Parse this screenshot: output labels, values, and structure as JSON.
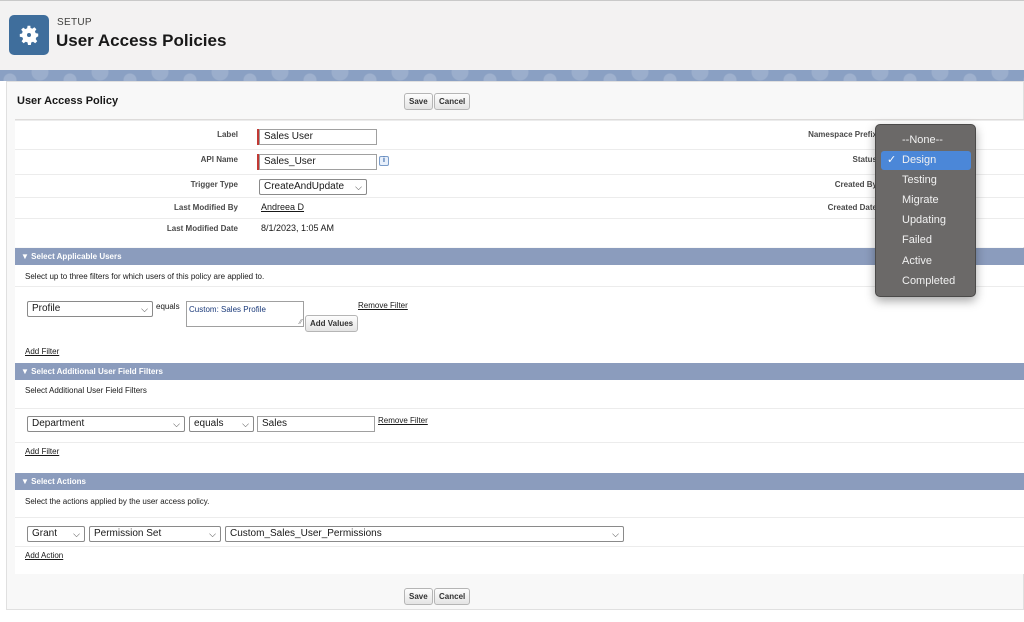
{
  "header": {
    "eyebrow": "SETUP",
    "title": "User Access Policies"
  },
  "card": {
    "title": "User Access Policy",
    "save_label": "Save",
    "cancel_label": "Cancel"
  },
  "details": {
    "label_label": "Label",
    "label_value": "Sales User",
    "api_name_label": "API Name",
    "api_name_value": "Sales_User",
    "info_glyph": "i",
    "trigger_type_label": "Trigger Type",
    "trigger_type_value": "CreateAndUpdate",
    "last_modified_by_label": "Last Modified By",
    "last_modified_by_value": "Andreea D",
    "last_modified_date_label": "Last Modified Date",
    "last_modified_date_value": "8/1/2023, 1:05 AM",
    "namespace_prefix_label": "Namespace Prefix",
    "status_label": "Status",
    "created_by_label": "Created By",
    "created_date_label": "Created Date"
  },
  "applicable_users": {
    "heading": "Select Applicable Users",
    "help": "Select up to three filters for which users of this policy are applied to.",
    "filter_field": "Profile",
    "operator": "equals",
    "values_text": "Custom: Sales Profile",
    "add_values_label": "Add Values",
    "remove_filter_label": "Remove Filter",
    "add_filter_label": "Add Filter"
  },
  "additional_filters": {
    "heading": "Select Additional User Field Filters",
    "help": "Select Additional User Field Filters",
    "filter_field": "Department",
    "operator": "equals",
    "value": "Sales",
    "remove_filter_label": "Remove Filter",
    "add_filter_label": "Add Filter"
  },
  "actions": {
    "heading": "Select Actions",
    "help": "Select the actions applied by the user access policy.",
    "action": "Grant",
    "type": "Permission Set",
    "target": "Custom_Sales_User_Permissions",
    "add_action_label": "Add Action"
  },
  "status_dropdown": {
    "options": [
      "--None--",
      "Design",
      "Testing",
      "Migrate",
      "Updating",
      "Failed",
      "Active",
      "Completed"
    ],
    "selected": "Design",
    "check_glyph": "✓"
  },
  "glyphs": {
    "collapse": "▼",
    "chevron": "⌵",
    "resize": "⁄⁄"
  },
  "colors": {
    "section_header": "#8b9cbd",
    "required": "#c23934",
    "dropdown_bg": "#6b6968",
    "dropdown_selected": "#4b87d8",
    "setup_icon": "#3f6e9c"
  }
}
